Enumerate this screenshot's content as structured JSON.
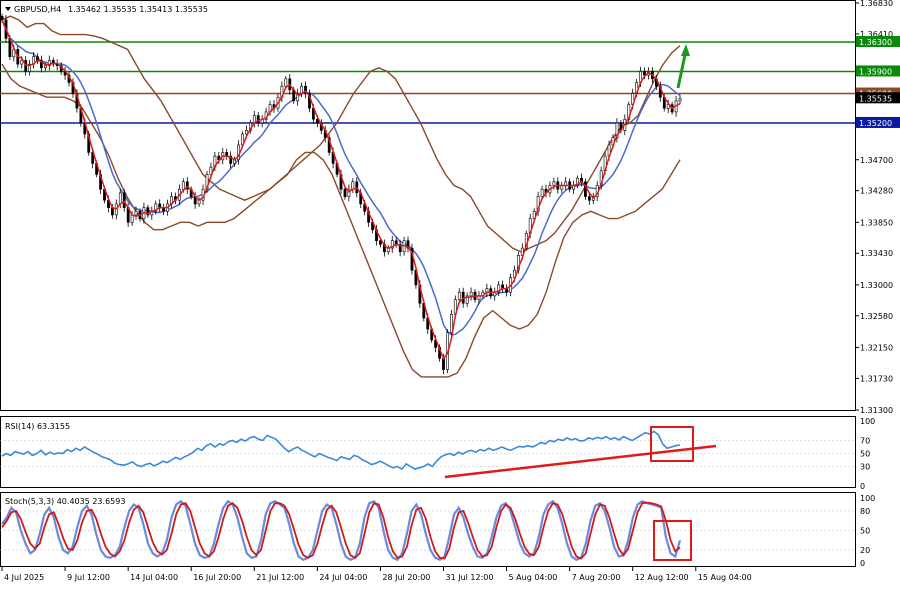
{
  "chart_data": [
    {
      "type": "candlestick",
      "panel": "price",
      "symbol_label": "GBPUSD,H4",
      "ohlc_label": "1.35462 1.35535 1.35413 1.35535",
      "ylim": [
        1.313,
        1.3683
      ],
      "y_ticks": [
        "1.36830",
        "1.36410",
        "1.36300",
        "1.35900",
        "1.35600",
        "1.35200",
        "1.34700",
        "1.34280",
        "1.33850",
        "1.33430",
        "1.33000",
        "1.32580",
        "1.32150",
        "1.31730",
        "1.31300"
      ],
      "y_tick_values": [
        1.3683,
        1.3641,
        1.363,
        1.359,
        1.356,
        1.352,
        1.347,
        1.3428,
        1.3385,
        1.3343,
        1.33,
        1.3258,
        1.3215,
        1.3173,
        1.313
      ],
      "highlight_ticks": [
        {
          "label": "1.36300",
          "value": 1.363,
          "color": "#0a8a0a"
        },
        {
          "label": "1.35900",
          "value": 1.359,
          "color": "#0a8a0a"
        },
        {
          "label": "1.35600",
          "value": 1.356,
          "color": "#8a4a2a"
        },
        {
          "label": "1.35200",
          "value": 1.352,
          "color": "#0a1aa0"
        }
      ],
      "current_price": 1.35535,
      "current_price_label": "1.35535",
      "levels": [
        {
          "value": 1.363,
          "color": "#0a8a0a"
        },
        {
          "value": 1.359,
          "color": "#0a8a0a"
        },
        {
          "value": 1.356,
          "color": "#8a4a2a"
        },
        {
          "value": 1.352,
          "color": "#0a1aa0"
        }
      ],
      "x_labels": [
        "4 Jul 2025",
        "9 Jul 12:00",
        "14 Jul 04:00",
        "16 Jul 20:00",
        "21 Jul 12:00",
        "24 Jul 04:00",
        "28 Jul 20:00",
        "31 Jul 12:00",
        "5 Aug 04:00",
        "7 Aug 20:00",
        "12 Aug 12:00",
        "15 Aug 04:00"
      ],
      "x_label_bars": [
        0,
        16,
        32,
        48,
        64,
        80,
        96,
        112,
        128,
        144,
        160,
        176
      ],
      "close_path": [
        1.366,
        1.3635,
        1.361,
        1.362,
        1.36,
        1.3605,
        1.359,
        1.36,
        1.361,
        1.3605,
        1.3595,
        1.3598,
        1.3605,
        1.36,
        1.3598,
        1.359,
        1.3585,
        1.3575,
        1.356,
        1.354,
        1.352,
        1.3505,
        1.348,
        1.3465,
        1.345,
        1.343,
        1.3415,
        1.3405,
        1.3395,
        1.341,
        1.3425,
        1.3405,
        1.3385,
        1.3395,
        1.34,
        1.339,
        1.3405,
        1.3395,
        1.34,
        1.341,
        1.3405,
        1.34,
        1.341,
        1.342,
        1.3415,
        1.343,
        1.344,
        1.343,
        1.342,
        1.341,
        1.3415,
        1.343,
        1.345,
        1.346,
        1.3475,
        1.347,
        1.348,
        1.3475,
        1.3465,
        1.347,
        1.349,
        1.3505,
        1.351,
        1.352,
        1.353,
        1.352,
        1.3525,
        1.3535,
        1.3545,
        1.354,
        1.3555,
        1.357,
        1.358,
        1.3565,
        1.355,
        1.356,
        1.357,
        1.356,
        1.354,
        1.3525,
        1.352,
        1.351,
        1.35,
        1.348,
        1.3465,
        1.345,
        1.343,
        1.342,
        1.343,
        1.344,
        1.3425,
        1.341,
        1.34,
        1.3385,
        1.3375,
        1.336,
        1.3355,
        1.3345,
        1.335,
        1.336,
        1.3355,
        1.3345,
        1.336,
        1.335,
        1.332,
        1.33,
        1.3275,
        1.3255,
        1.324,
        1.3225,
        1.3215,
        1.32,
        1.3185,
        1.3235,
        1.326,
        1.328,
        1.329,
        1.3275,
        1.3285,
        1.329,
        1.328,
        1.3285,
        1.329,
        1.3295,
        1.3285,
        1.329,
        1.33,
        1.3295,
        1.329,
        1.331,
        1.332,
        1.334,
        1.335,
        1.337,
        1.339,
        1.34,
        1.342,
        1.343,
        1.3425,
        1.3435,
        1.344,
        1.343,
        1.3435,
        1.344,
        1.343,
        1.3435,
        1.3445,
        1.344,
        1.342,
        1.3415,
        1.342,
        1.3435,
        1.3455,
        1.3475,
        1.349,
        1.35,
        1.352,
        1.351,
        1.3525,
        1.3545,
        1.356,
        1.3575,
        1.359,
        1.3585,
        1.359,
        1.358,
        1.357,
        1.3555,
        1.354,
        1.3545,
        1.3535,
        1.355,
        1.35535
      ],
      "series": [
        {
          "kind": "upper-band",
          "values": [
            1.366,
            1.3665,
            1.366,
            1.365,
            1.3655,
            1.3655,
            1.3645,
            1.364,
            1.364,
            1.364,
            1.364,
            1.3638,
            1.3635,
            1.363,
            1.3625,
            1.362,
            1.36,
            1.358,
            1.3565,
            1.355,
            1.353,
            1.351,
            1.349,
            1.347,
            1.345,
            1.344,
            1.343,
            1.3425,
            1.342,
            1.3415,
            1.342,
            1.3425,
            1.343,
            1.344,
            1.345,
            1.346,
            1.347,
            1.348,
            1.349,
            1.3505,
            1.352,
            1.354,
            1.356,
            1.3575,
            1.359,
            1.3595,
            1.359,
            1.358,
            1.356,
            1.354,
            1.352,
            1.3495,
            1.347,
            1.345,
            1.3435,
            1.343,
            1.342,
            1.34,
            1.338,
            1.337,
            1.336,
            1.335,
            1.3345,
            1.335,
            1.3355,
            1.336,
            1.337,
            1.3385,
            1.34,
            1.342,
            1.344,
            1.346,
            1.348,
            1.35,
            1.3515,
            1.352,
            1.353,
            1.3555,
            1.358,
            1.36,
            1.3615,
            1.3625
          ]
        },
        {
          "kind": "lower-band",
          "values": [
            1.36,
            1.358,
            1.357,
            1.3565,
            1.356,
            1.3555,
            1.3555,
            1.3555,
            1.355,
            1.354,
            1.352,
            1.35,
            1.3475,
            1.3445,
            1.342,
            1.34,
            1.3385,
            1.3375,
            1.3375,
            1.338,
            1.3385,
            1.3385,
            1.338,
            1.3385,
            1.3385,
            1.3385,
            1.339,
            1.34,
            1.341,
            1.342,
            1.343,
            1.344,
            1.345,
            1.347,
            1.348,
            1.348,
            1.347,
            1.345,
            1.342,
            1.339,
            1.336,
            1.333,
            1.33,
            1.327,
            1.324,
            1.321,
            1.3185,
            1.3175,
            1.3175,
            1.3175,
            1.3175,
            1.318,
            1.32,
            1.323,
            1.3255,
            1.3265,
            1.3255,
            1.3245,
            1.324,
            1.3245,
            1.326,
            1.329,
            1.333,
            1.3365,
            1.3385,
            1.3395,
            1.34,
            1.3395,
            1.339,
            1.339,
            1.3395,
            1.34,
            1.341,
            1.342,
            1.343,
            1.345,
            1.347
          ]
        }
      ]
    },
    {
      "type": "line",
      "panel": "rsi",
      "label": "RSI(14) 63.3155",
      "ylim": [
        0,
        100
      ],
      "y_ticks": [
        "100",
        "70",
        "50",
        "30",
        "0"
      ],
      "y_tick_values": [
        100,
        70,
        50,
        30,
        0
      ],
      "values": [
        46,
        50,
        47,
        53,
        51,
        49,
        53,
        47,
        50,
        55,
        48,
        52,
        49,
        51,
        50,
        56,
        53,
        58,
        55,
        60,
        56,
        52,
        49,
        45,
        43,
        40,
        35,
        33,
        32,
        34,
        37,
        32,
        30,
        33,
        35,
        31,
        34,
        38,
        36,
        40,
        44,
        41,
        45,
        48,
        52,
        58,
        55,
        62,
        65,
        60,
        65,
        63,
        68,
        70,
        67,
        72,
        69,
        74,
        76,
        72,
        70,
        78,
        75,
        72,
        65,
        58,
        53,
        57,
        60,
        55,
        52,
        48,
        45,
        50,
        47,
        44,
        42,
        39,
        45,
        43,
        41,
        47,
        45,
        40,
        37,
        33,
        35,
        38,
        35,
        31,
        28,
        30,
        26,
        34,
        30,
        26,
        28,
        30,
        34,
        30,
        38,
        45,
        48,
        50,
        47,
        52,
        49,
        53,
        55,
        52,
        56,
        54,
        58,
        55,
        57,
        60,
        57,
        55,
        58,
        61,
        60,
        62,
        60,
        63,
        67,
        65,
        70,
        68,
        72,
        70,
        74,
        71,
        73,
        69,
        70,
        74,
        72,
        75,
        73,
        76,
        72,
        74,
        71,
        76,
        73,
        70,
        74,
        78,
        82,
        80,
        84,
        79,
        65,
        58,
        60,
        62,
        63
      ]
    },
    {
      "type": "line",
      "panel": "stochastic",
      "label": "Stoch(5,3,3) 40.4035 23.6593",
      "ylim": [
        0,
        100
      ],
      "y_ticks": [
        "100",
        "80",
        "50",
        "20",
        "0"
      ],
      "y_tick_values": [
        100,
        80,
        50,
        20,
        0
      ],
      "series": [
        {
          "name": "main",
          "values": [
            60,
            70,
            85,
            78,
            50,
            30,
            15,
            20,
            45,
            75,
            85,
            70,
            40,
            20,
            15,
            25,
            55,
            80,
            88,
            75,
            45,
            20,
            10,
            8,
            12,
            25,
            55,
            80,
            90,
            85,
            60,
            30,
            15,
            10,
            15,
            35,
            70,
            90,
            95,
            88,
            60,
            30,
            12,
            8,
            10,
            30,
            60,
            85,
            95,
            90,
            70,
            40,
            15,
            8,
            10,
            35,
            75,
            92,
            95,
            90,
            85,
            60,
            30,
            10,
            5,
            8,
            20,
            50,
            80,
            90,
            85,
            60,
            30,
            10,
            5,
            8,
            30,
            70,
            92,
            95,
            85,
            50,
            20,
            8,
            5,
            15,
            45,
            80,
            90,
            75,
            45,
            20,
            8,
            5,
            10,
            40,
            75,
            85,
            70,
            45,
            25,
            10,
            8,
            15,
            40,
            70,
            88,
            92,
            80,
            55,
            30,
            15,
            10,
            15,
            40,
            75,
            90,
            95,
            85,
            60,
            30,
            10,
            5,
            8,
            30,
            65,
            88,
            92,
            80,
            55,
            25,
            10,
            12,
            35,
            70,
            90,
            95,
            92,
            90,
            88,
            85,
            40,
            15,
            10,
            35
          ]
        },
        {
          "name": "signal",
          "values": [
            55,
            65,
            78,
            80,
            68,
            48,
            30,
            22,
            30,
            55,
            75,
            78,
            60,
            38,
            22,
            20,
            35,
            62,
            80,
            82,
            68,
            45,
            25,
            14,
            10,
            18,
            35,
            62,
            82,
            88,
            78,
            55,
            32,
            18,
            13,
            20,
            45,
            75,
            90,
            92,
            80,
            55,
            30,
            15,
            10,
            18,
            40,
            68,
            88,
            92,
            85,
            65,
            40,
            20,
            12,
            20,
            50,
            80,
            92,
            92,
            88,
            75,
            52,
            28,
            12,
            8,
            12,
            30,
            58,
            82,
            88,
            78,
            55,
            30,
            12,
            8,
            15,
            45,
            78,
            92,
            90,
            70,
            40,
            18,
            8,
            10,
            25,
            58,
            82,
            85,
            68,
            40,
            18,
            8,
            7,
            22,
            55,
            78,
            80,
            62,
            40,
            20,
            10,
            12,
            25,
            55,
            80,
            90,
            85,
            68,
            45,
            25,
            14,
            12,
            25,
            55,
            80,
            92,
            90,
            75,
            50,
            25,
            10,
            7,
            15,
            45,
            75,
            90,
            88,
            70,
            45,
            22,
            12,
            22,
            50,
            78,
            92,
            93,
            92,
            90,
            87,
            65,
            35,
            18,
            24
          ]
        }
      ]
    }
  ]
}
